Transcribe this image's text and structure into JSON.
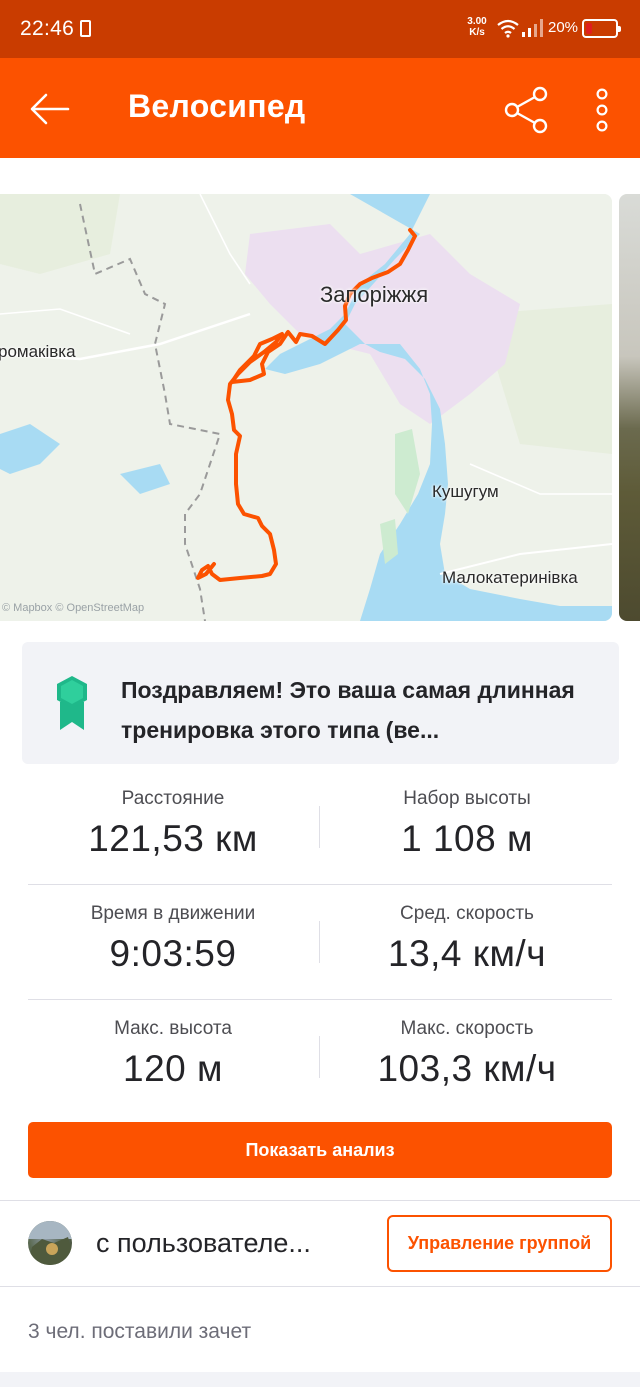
{
  "status_bar": {
    "time": "22:46",
    "net_speed_value": "3.00",
    "net_speed_unit": "K/s",
    "battery_percent": "20%",
    "battery_level": 0.2,
    "icons": [
      "battery-saver-icon",
      "wifi-icon",
      "signal-icon",
      "battery-icon"
    ]
  },
  "app_bar": {
    "title": "Велосипед",
    "icons": [
      "back-arrow-icon",
      "share-icon",
      "more-vertical-icon"
    ]
  },
  "map": {
    "labels": {
      "city": "Запоріжжя",
      "west": "ромаківка",
      "kushugum": "Кушугум",
      "malokaterynivka": "Малокатеринівка"
    },
    "attribution": "© Mapbox © OpenStreetMap",
    "route_color": "#fc5200",
    "water_color": "#a8dbf3",
    "urban_color": "#ecdff0"
  },
  "achievement": {
    "text": "Поздравляем! Это ваша самая длинная тренировка этого типа (ве...",
    "icon": "achievement-badge-icon",
    "icon_color": "#1fb88a"
  },
  "stats": [
    {
      "left": {
        "label": "Расстояние",
        "value": "121,53 км"
      },
      "right": {
        "label": "Набор высоты",
        "value": "1 108 м"
      }
    },
    {
      "left": {
        "label": "Время в движении",
        "value": "9:03:59"
      },
      "right": {
        "label": "Сред. скорость",
        "value": "13,4 км/ч"
      }
    },
    {
      "left": {
        "label": "Макс. высота",
        "value": "120 м"
      },
      "right": {
        "label": "Макс. скорость",
        "value": "103,3 км/ч"
      }
    }
  ],
  "analysis_button": "Показать анализ",
  "group": {
    "text": "с пользователе...",
    "manage_button": "Управление группой"
  },
  "kudos": "3 чел. поставили зачет",
  "colors": {
    "brand": "#fc5200",
    "status_bar": "#c93c00"
  }
}
